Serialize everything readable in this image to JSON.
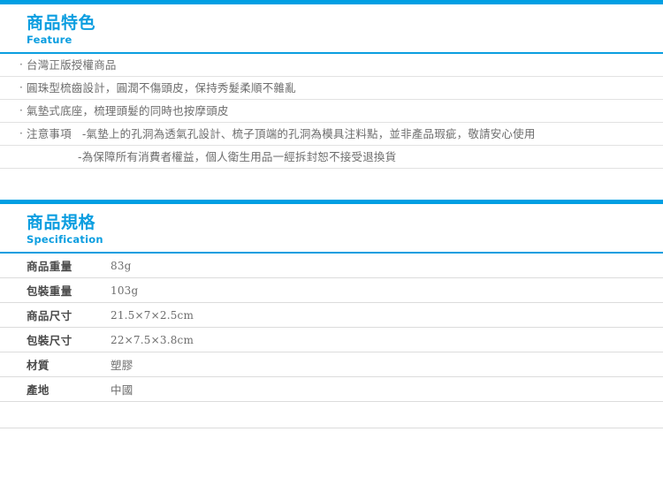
{
  "theme": {
    "accent_blue": "#009fe3",
    "title_blue": "#0c9ee0",
    "body_gray": "#6d6d6d",
    "label_gray": "#4a4a4a",
    "rule_gray": "#e2e2e2"
  },
  "feature_section": {
    "title_zh": "商品特色",
    "title_en": "Feature",
    "bullet_glyph": "·",
    "items": [
      {
        "text": "台灣正版授權商品",
        "type": "bullet"
      },
      {
        "text": "圓珠型梳齒設計，圓潤不傷頭皮，保持秀髮柔順不雜亂",
        "type": "bullet"
      },
      {
        "text": "氣墊式底座，梳理頭髮的同時也按摩頭皮",
        "type": "bullet"
      },
      {
        "label": "注意事項",
        "text": "-氣墊上的孔洞為透氣孔設計、梳子頂端的孔洞為模具注料點，並非產品瑕疵，敬請安心使用",
        "type": "note"
      },
      {
        "text": "-為保障所有消費者權益，個人衛生用品一經拆封恕不接受退換貨",
        "type": "continuation"
      }
    ]
  },
  "spec_section": {
    "title_zh": "商品規格",
    "title_en": "Specification",
    "rows": [
      {
        "label": "商品重量",
        "value": "83g",
        "cjk": false
      },
      {
        "label": "包裝重量",
        "value": "103g",
        "cjk": false
      },
      {
        "label": "商品尺寸",
        "value": "21.5×7×2.5cm",
        "cjk": false
      },
      {
        "label": "包裝尺寸",
        "value": "22×7.5×3.8cm",
        "cjk": false
      },
      {
        "label": "材質",
        "value": "塑膠",
        "cjk": true
      },
      {
        "label": "產地",
        "value": "中國",
        "cjk": true
      },
      {
        "label": "",
        "value": "",
        "cjk": true
      }
    ]
  }
}
